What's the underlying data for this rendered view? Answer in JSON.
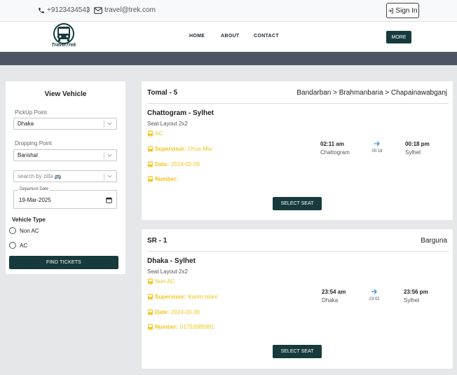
{
  "topbar": {
    "phone": "+9123434543",
    "separator": "|",
    "email": "travel@trek.com",
    "signin_label": "Sign In"
  },
  "nav": {
    "logo_text": "TravelTrek",
    "links": [
      "HOME",
      "ABOUT",
      "CONTACT"
    ],
    "more_label": "MORE"
  },
  "filter": {
    "title": "View Vehicle",
    "pickup_label": "PickUp Point",
    "pickup_value": "Dhaka",
    "dropping_label": "Dropping Point",
    "dropping_value": "Barishal",
    "search_placeholder": "search by zilla 🚌",
    "date_label": "Departure Date",
    "date_value": "19-Mar-2025",
    "vehicle_type_label": "Vehicle Type",
    "options": [
      "Non AC",
      "AC"
    ],
    "find_label": "FIND TICKETS"
  },
  "cards": [
    {
      "bus": "Tomal - 5",
      "route_path": "Bandarban > Brahmanbaria > Chapainawabganj",
      "trip": "Chattogram - Sylhet",
      "seat_layout": "Seat Layout 2x2",
      "class": "AC",
      "supervisor_label": "Supervisor:",
      "supervisor": "Unus Mia",
      "date_label": "Date:",
      "date": "2024-02-29",
      "number_label": "Number:",
      "number": "",
      "dep_time": "02:11 am",
      "dep_place": "Chattogram",
      "duration": "00:18",
      "arr_time": "00:18 pm",
      "arr_place": "Sylhet",
      "select_label": "SELECT SEAT"
    },
    {
      "bus": "SR - 1",
      "route_path": "Barguna",
      "trip": "Dhaka - Sylhet",
      "seat_layout": "Seat Layout 2x2",
      "class": "Non-AC",
      "supervisor_label": "Supervisor:",
      "supervisor": "Karim Islam",
      "date_label": "Date:",
      "date": "2024-03-30",
      "number_label": "Number:",
      "number": "01753985991",
      "dep_time": "23:54 am",
      "dep_place": "Dhaka",
      "duration": "23:02",
      "arr_time": "23:56 pm",
      "arr_place": "Sylhet",
      "select_label": "SELECT SEAT"
    }
  ],
  "colors": {
    "primary": "#173a3d",
    "accent_yellow": "#f0c419",
    "banner": "#4b5563",
    "arrow_blue": "#3b8fd9"
  }
}
